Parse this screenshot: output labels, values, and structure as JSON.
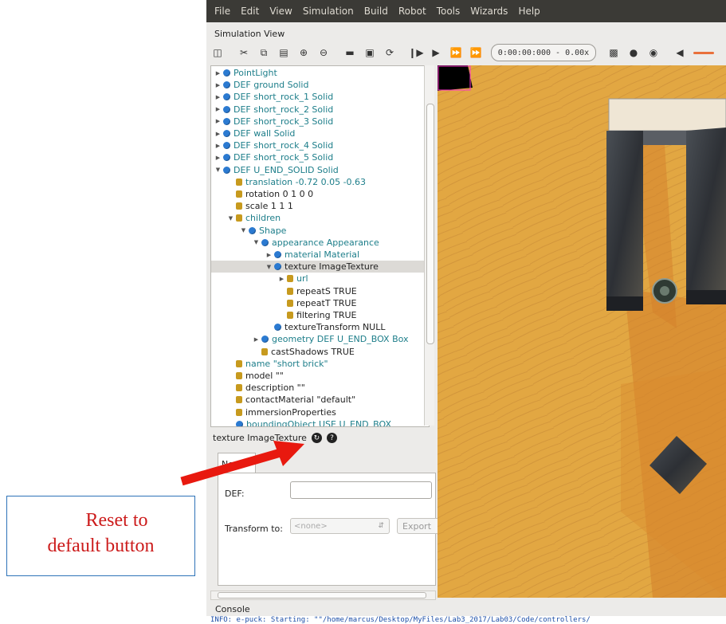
{
  "menubar": {
    "items": [
      "File",
      "Edit",
      "View",
      "Simulation",
      "Build",
      "Robot",
      "Tools",
      "Wizards",
      "Help"
    ]
  },
  "panel": {
    "title": "Simulation View"
  },
  "toolbar": {
    "time": "0:00:00:000  -  0.00x"
  },
  "scene_tree": {
    "nodes": [
      {
        "label": "PointLight",
        "depth": 0,
        "icon": "node",
        "expander": "collapsed",
        "color": "teal"
      },
      {
        "label": "DEF ground Solid",
        "depth": 0,
        "icon": "node",
        "expander": "collapsed",
        "color": "teal"
      },
      {
        "label": "DEF short_rock_1 Solid",
        "depth": 0,
        "icon": "node",
        "expander": "collapsed",
        "color": "teal"
      },
      {
        "label": "DEF short_rock_2 Solid",
        "depth": 0,
        "icon": "node",
        "expander": "collapsed",
        "color": "teal"
      },
      {
        "label": "DEF short_rock_3 Solid",
        "depth": 0,
        "icon": "node",
        "expander": "collapsed",
        "color": "teal"
      },
      {
        "label": "DEF wall Solid",
        "depth": 0,
        "icon": "node",
        "expander": "collapsed",
        "color": "teal"
      },
      {
        "label": "DEF short_rock_4 Solid",
        "depth": 0,
        "icon": "node",
        "expander": "collapsed",
        "color": "teal"
      },
      {
        "label": "DEF short_rock_5 Solid",
        "depth": 0,
        "icon": "node",
        "expander": "collapsed",
        "color": "teal"
      },
      {
        "label": "DEF U_END_SOLID Solid",
        "depth": 0,
        "icon": "node",
        "expander": "expanded",
        "color": "teal"
      },
      {
        "label": "translation -0.72 0.05 -0.63",
        "depth": 1,
        "icon": "field",
        "expander": "none",
        "color": "teal"
      },
      {
        "label": "rotation 0 1 0 0",
        "depth": 1,
        "icon": "field",
        "expander": "none",
        "color": "dark"
      },
      {
        "label": "scale 1 1 1",
        "depth": 1,
        "icon": "field",
        "expander": "none",
        "color": "dark"
      },
      {
        "label": "children",
        "depth": 1,
        "icon": "field",
        "expander": "expanded",
        "color": "teal"
      },
      {
        "label": "Shape",
        "depth": 2,
        "icon": "node",
        "expander": "expanded",
        "color": "teal"
      },
      {
        "label": "appearance Appearance",
        "depth": 3,
        "icon": "node",
        "expander": "expanded",
        "color": "teal"
      },
      {
        "label": "material Material",
        "depth": 4,
        "icon": "node",
        "expander": "collapsed",
        "color": "teal"
      },
      {
        "label": "texture ImageTexture",
        "depth": 4,
        "icon": "node",
        "expander": "expanded",
        "color": "dark",
        "selected": true
      },
      {
        "label": "url",
        "depth": 5,
        "icon": "field",
        "expander": "collapsed",
        "color": "teal"
      },
      {
        "label": "repeatS TRUE",
        "depth": 5,
        "icon": "field",
        "expander": "none",
        "color": "dark"
      },
      {
        "label": "repeatT TRUE",
        "depth": 5,
        "icon": "field",
        "expander": "none",
        "color": "dark"
      },
      {
        "label": "filtering TRUE",
        "depth": 5,
        "icon": "field",
        "expander": "none",
        "color": "dark"
      },
      {
        "label": "textureTransform NULL",
        "depth": 4,
        "icon": "node",
        "expander": "none",
        "color": "dark"
      },
      {
        "label": "geometry DEF U_END_BOX Box",
        "depth": 3,
        "icon": "node",
        "expander": "collapsed",
        "color": "teal"
      },
      {
        "label": "castShadows TRUE",
        "depth": 3,
        "icon": "field",
        "expander": "none",
        "color": "dark"
      },
      {
        "label": "name \"short brick\"",
        "depth": 1,
        "icon": "field",
        "expander": "none",
        "color": "teal"
      },
      {
        "label": "model \"\"",
        "depth": 1,
        "icon": "field",
        "expander": "none",
        "color": "dark"
      },
      {
        "label": "description \"\"",
        "depth": 1,
        "icon": "field",
        "expander": "none",
        "color": "dark"
      },
      {
        "label": "contactMaterial \"default\"",
        "depth": 1,
        "icon": "field",
        "expander": "none",
        "color": "dark"
      },
      {
        "label": "immersionProperties",
        "depth": 1,
        "icon": "field",
        "expander": "none",
        "color": "dark"
      },
      {
        "label": "boundingObject USE U_END_BOX",
        "depth": 1,
        "icon": "node",
        "expander": "none",
        "color": "teal"
      }
    ]
  },
  "properties": {
    "title": "texture ImageTexture",
    "tab": "Node",
    "def_label": "DEF:",
    "def_value": "",
    "transform_label": "Transform to:",
    "transform_value": "<none>",
    "export_label": "Export"
  },
  "console": {
    "title": "Console",
    "line": "INFO: e-puck: Starting: \"\"/home/marcus/Desktop/MyFiles/Lab3_2017/Lab03/Code/controllers/"
  },
  "annotation": {
    "line1": "Reset to",
    "line2": "default button",
    "color": "#cc1b1b"
  },
  "colors": {
    "menubar": "#3b3a36",
    "node_icon": "#2b7ad1",
    "field_icon": "#c79a1e",
    "teal_text": "#1d7e8a",
    "floor": "#e2a742"
  }
}
